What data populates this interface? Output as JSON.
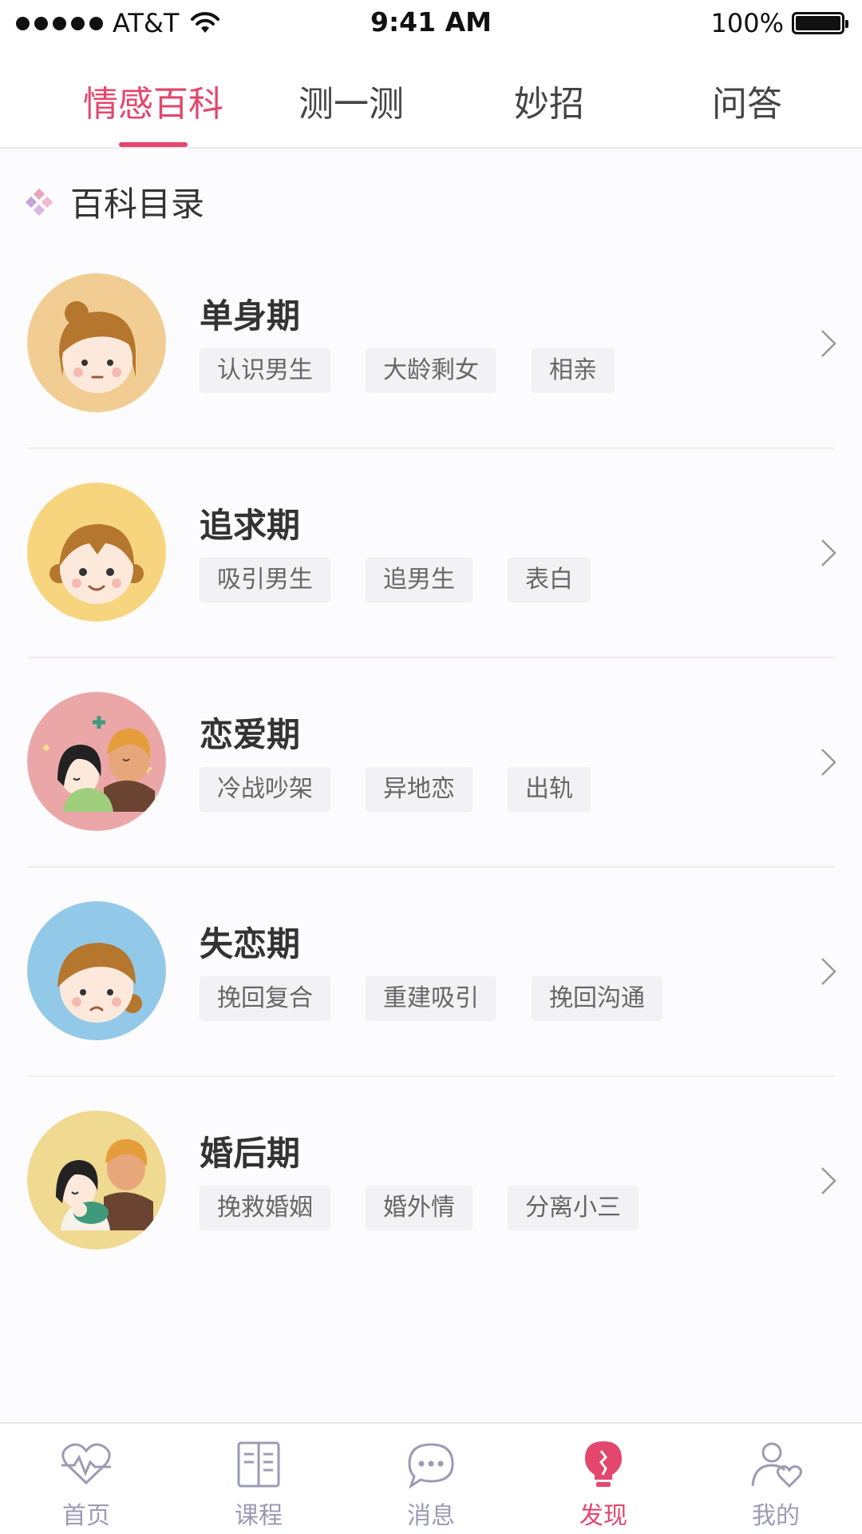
{
  "status_bar": {
    "carrier": "AT&T",
    "time": "9:41 AM",
    "battery": "100%"
  },
  "top_tabs": [
    {
      "label": "情感百科",
      "active": true
    },
    {
      "label": "测一测",
      "active": false
    },
    {
      "label": "妙招",
      "active": false
    },
    {
      "label": "问答",
      "active": false
    }
  ],
  "section": {
    "title": "百科目录"
  },
  "stages": [
    {
      "title": "单身期",
      "tags": [
        "认识男生",
        "大龄剩女",
        "相亲"
      ],
      "avatar_bg": "#f2cd93"
    },
    {
      "title": "追求期",
      "tags": [
        "吸引男生",
        "追男生",
        "表白"
      ],
      "avatar_bg": "#f7d57e"
    },
    {
      "title": "恋爱期",
      "tags": [
        "冷战吵架",
        "异地恋",
        "出轨"
      ],
      "avatar_bg": "#eba7a8"
    },
    {
      "title": "失恋期",
      "tags": [
        "挽回复合",
        "重建吸引",
        "挽回沟通"
      ],
      "avatar_bg": "#92c9e8"
    },
    {
      "title": "婚后期",
      "tags": [
        "挽救婚姻",
        "婚外情",
        "分离小三"
      ],
      "avatar_bg": "#f0d991"
    }
  ],
  "bottom_nav": [
    {
      "label": "首页",
      "icon": "heart-pulse-icon",
      "active": false
    },
    {
      "label": "课程",
      "icon": "book-icon",
      "active": false
    },
    {
      "label": "消息",
      "icon": "chat-bubble-icon",
      "active": false
    },
    {
      "label": "发现",
      "icon": "lightbulb-icon",
      "active": true
    },
    {
      "label": "我的",
      "icon": "user-heart-icon",
      "active": false
    }
  ],
  "colors": {
    "accent": "#e3476d",
    "nav_inactive": "#9b9bb4"
  }
}
